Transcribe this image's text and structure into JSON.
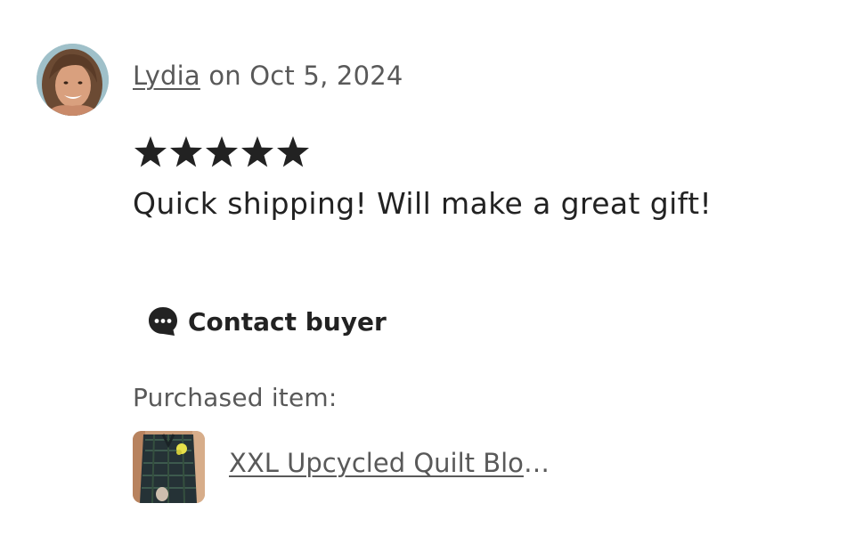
{
  "review": {
    "reviewer_name": "Lydia",
    "date_text": " on Oct 5, 2024",
    "rating": 5,
    "rating_max": 5,
    "text": "Quick shipping! Will make a great gift!"
  },
  "contact": {
    "label": "Contact buyer",
    "icon": "chat-bubble-icon"
  },
  "purchased": {
    "label": "Purchased item:",
    "item_title": "XXL Upcycled Quilt Block Flannel Shirt"
  },
  "colors": {
    "text_primary": "#222222",
    "text_secondary": "#595959",
    "star": "#222222"
  }
}
